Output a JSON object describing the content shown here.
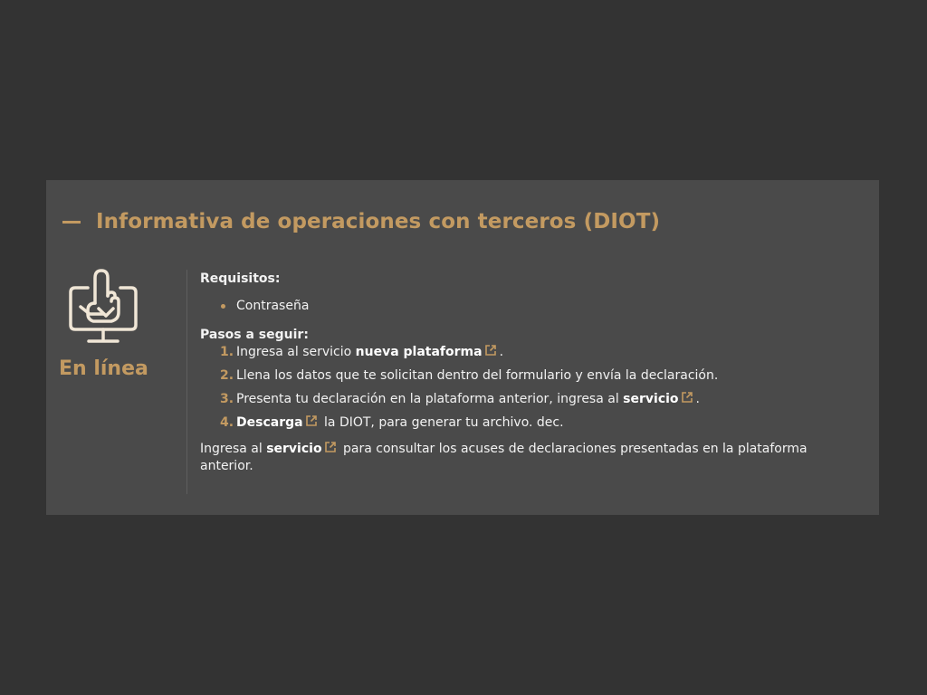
{
  "colors": {
    "page_background": "#333333",
    "panel_background": "#4a4a4a",
    "accent": "#c39a61",
    "text": "#f2f2f2"
  },
  "section": {
    "title": "Informativa de operaciones con terceros (DIOT)",
    "expanded": true,
    "toggle_icon": "minus-icon"
  },
  "channel": {
    "icon": "online-computer-hand-icon",
    "label": "En línea"
  },
  "requirements": {
    "title": "Requisitos:",
    "items": [
      "Contraseña"
    ]
  },
  "steps": {
    "title": "Pasos a seguir:",
    "items": [
      {
        "number": "1.",
        "before": "Ingresa al servicio ",
        "link": "nueva plataforma",
        "after": "."
      },
      {
        "number": "2.",
        "text": "Llena los datos que te solicitan dentro del formulario y envía la declaración."
      },
      {
        "number": "3.",
        "before": "Presenta tu declaración en la plataforma anterior, ingresa al ",
        "link": "servicio",
        "after": "."
      },
      {
        "number": "4.",
        "link": "Descarga",
        "after": " la DIOT, para generar tu archivo. dec."
      }
    ]
  },
  "footer": {
    "before": "Ingresa al ",
    "link": "servicio",
    "after": " para consultar los acuses de declaraciones presentadas en la plataforma anterior."
  },
  "external_link_icon": "external-link-icon"
}
